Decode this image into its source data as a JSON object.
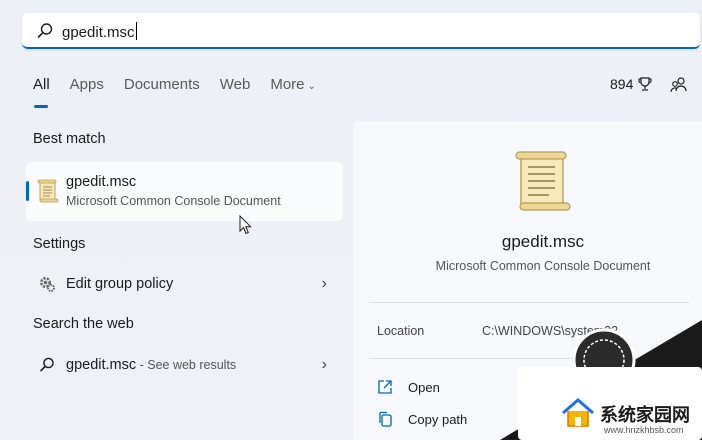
{
  "search": {
    "query": "gpedit.msc"
  },
  "tabs": [
    {
      "label": "All",
      "active": true
    },
    {
      "label": "Apps"
    },
    {
      "label": "Documents"
    },
    {
      "label": "Web"
    },
    {
      "label": "More"
    }
  ],
  "header": {
    "points": "894",
    "trophy_icon": "trophy-icon",
    "people_icon": "people-icon"
  },
  "sections": {
    "best_match": "Best match",
    "settings": "Settings",
    "search_web": "Search the web"
  },
  "best_match": {
    "title": "gpedit.msc",
    "subtitle": "Microsoft Common Console Document",
    "icon": "document-scroll-icon"
  },
  "settings_items": [
    {
      "label": "Edit group policy",
      "icon": "gear-icon"
    }
  ],
  "web_items": [
    {
      "label": "gpedit.msc",
      "suffix": " - See web results",
      "icon": "search-icon"
    }
  ],
  "preview": {
    "title": "gpedit.msc",
    "subtitle": "Microsoft Common Console Document",
    "location_label": "Location",
    "location_value": "C:\\WINDOWS\\system32",
    "actions": [
      {
        "label": "Open",
        "icon": "open-external-icon"
      },
      {
        "label": "Copy path",
        "icon": "copy-icon"
      }
    ]
  },
  "watermark": {
    "title": "系统家园网",
    "url": "www.hnzkhbsb.com"
  },
  "colors": {
    "accent": "#0067c0",
    "background": "#eef1f7",
    "pane": "#f7f8fb"
  }
}
